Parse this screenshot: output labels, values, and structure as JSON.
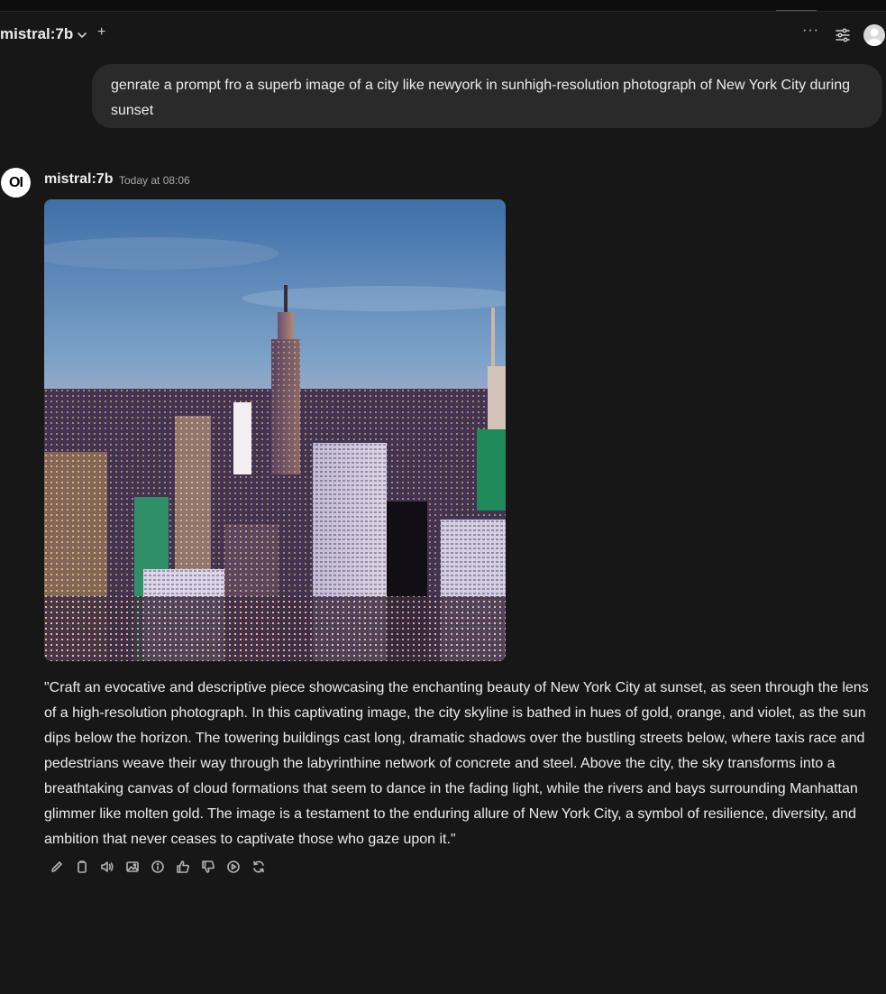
{
  "header": {
    "model_name": "mistral:7b",
    "new_chat_symbol": "+",
    "more_symbol": "···"
  },
  "user_message": {
    "text": "genrate a prompt fro a superb image of a city like newyork in sunhigh-resolution photograph of New York City during sunset"
  },
  "assistant_message": {
    "avatar_text": "OI",
    "model_name": "mistral:7b",
    "timestamp": "Today at 08:06",
    "image_subject": "New York City skyline at sunset (generated image)",
    "response_text": "\"Craft an evocative and descriptive piece showcasing the enchanting beauty of New York City at sunset, as seen through the lens of a high-resolution photograph. In this captivating image, the city skyline is bathed in hues of gold, orange, and violet, as the sun dips below the horizon. The towering buildings cast long, dramatic shadows over the bustling streets below, where taxis race and pedestrians weave their way through the labyrinthine network of concrete and steel. Above the city, the sky transforms into a breathtaking canvas of cloud formations that seem to dance in the fading light, while the rivers and bays surrounding Manhattan glimmer like molten gold. The image is a testament to the enduring allure of New York City, a symbol of resilience, diversity, and ambition that never ceases to captivate those who gaze upon it.\""
  },
  "action_icons": [
    "edit-icon",
    "copy-icon",
    "speaker-icon",
    "image-icon",
    "info-icon",
    "thumbs-up-icon",
    "thumbs-down-icon",
    "play-icon",
    "regenerate-icon"
  ],
  "colors": {
    "background": "#171717",
    "user_bubble": "#2a2a2a",
    "text": "#ececec",
    "muted": "#a8a8a8"
  }
}
